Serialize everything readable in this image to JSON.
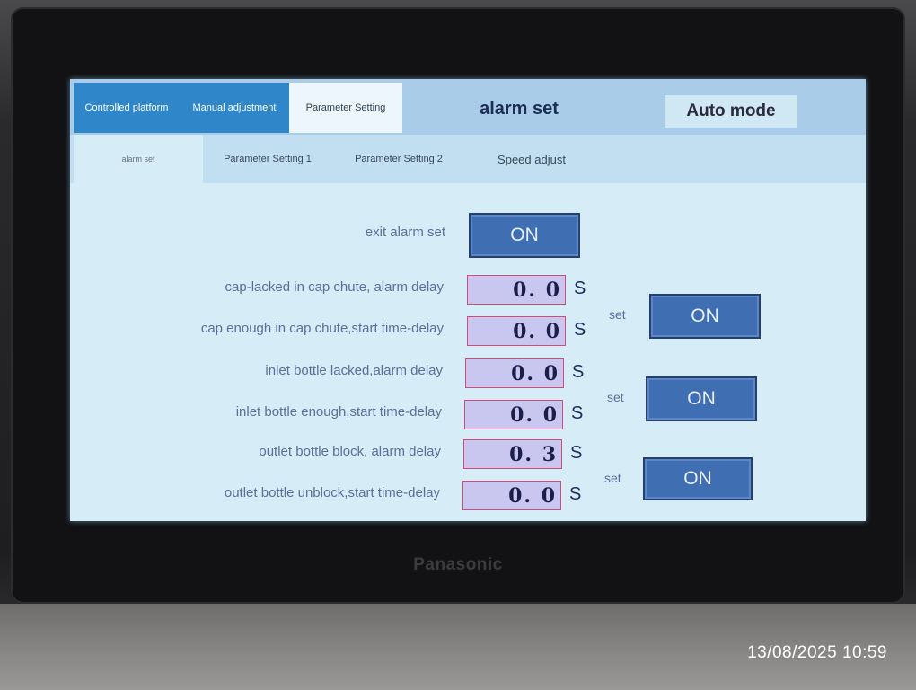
{
  "tabs": {
    "top": [
      "Controlled platform",
      "Manual adjustment",
      "Parameter Setting"
    ],
    "title": "alarm set",
    "mode_button": "Auto mode",
    "sub": [
      "alarm set",
      "Parameter Setting 1",
      "Parameter Setting 2",
      "Speed adjust"
    ]
  },
  "exit_alarm": {
    "label": "exit alarm set",
    "button": "ON"
  },
  "rows": [
    {
      "label": "cap-lacked in cap chute, alarm delay",
      "value": "0. 0",
      "unit": "S"
    },
    {
      "label": "cap enough in cap chute,start time-delay",
      "value": "0. 0",
      "unit": "S"
    },
    {
      "label": "inlet bottle lacked,alarm delay",
      "value": "0. 0",
      "unit": "S"
    },
    {
      "label": "inlet bottle enough,start time-delay",
      "value": "0. 0",
      "unit": "S"
    },
    {
      "label": "outlet bottle block, alarm delay",
      "value": "0. 3",
      "unit": "S"
    },
    {
      "label": "outlet bottle unblock,start time-delay",
      "value": "0. 0",
      "unit": "S"
    }
  ],
  "set_buttons": [
    {
      "label": "set",
      "button": "ON"
    },
    {
      "label": "set",
      "button": "ON"
    },
    {
      "label": "set",
      "button": "ON"
    }
  ],
  "brand": "Panasonic",
  "timestamp": "13/08/2025 10:59"
}
